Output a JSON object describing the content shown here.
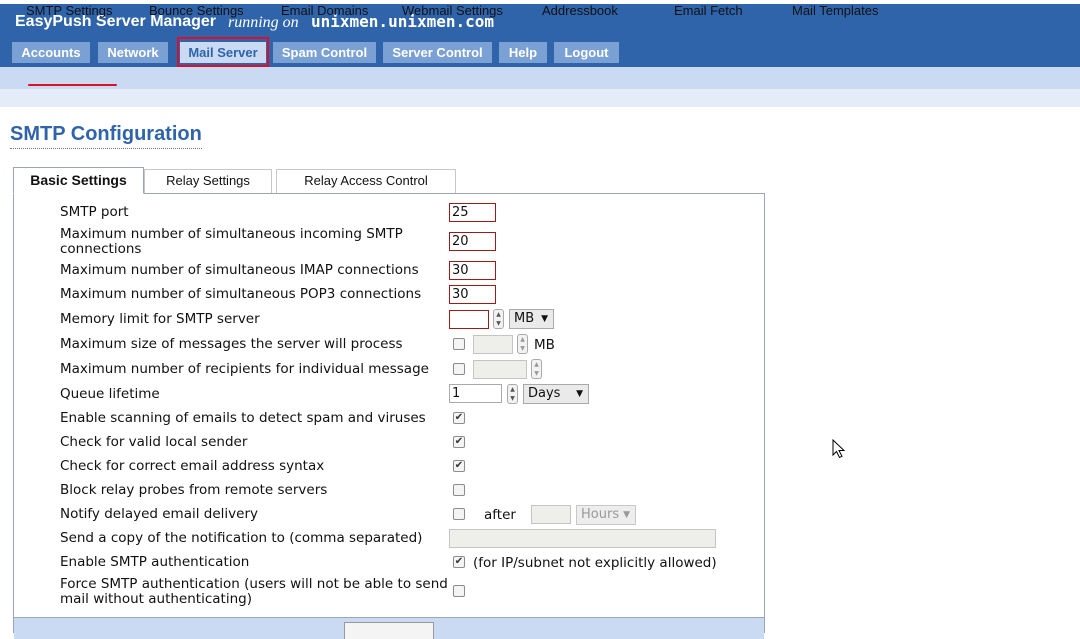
{
  "header": {
    "app_title": "EasyPush Server Manager",
    "running_on": "running on",
    "hostname": "unixmen.unixmen.com"
  },
  "main_tabs": [
    {
      "label": "Accounts"
    },
    {
      "label": "Network"
    },
    {
      "label": "Mail Server",
      "active": true
    },
    {
      "label": "Spam Control"
    },
    {
      "label": "Server Control"
    },
    {
      "label": "Help"
    },
    {
      "label": "Logout"
    }
  ],
  "sub_nav": [
    {
      "label": "SMTP Settings",
      "active": true
    },
    {
      "label": "Bounce Settings"
    },
    {
      "label": "Email Domains"
    },
    {
      "label": "Webmail Settings"
    },
    {
      "label": "Addressbook"
    },
    {
      "label": "Email Fetch"
    },
    {
      "label": "Mail Templates"
    }
  ],
  "page_title": "SMTP Configuration",
  "panel_tabs": [
    {
      "label": "Basic Settings",
      "active": true
    },
    {
      "label": "Relay Settings"
    },
    {
      "label": "Relay Access Control"
    }
  ],
  "settings": {
    "smtp_port": {
      "label": "SMTP port",
      "value": "25"
    },
    "max_incoming_smtp": {
      "label": "Maximum number of simultaneous incoming SMTP connections",
      "value": "20"
    },
    "max_imap": {
      "label": "Maximum number of simultaneous IMAP connections",
      "value": "30"
    },
    "max_pop3": {
      "label": "Maximum number of simultaneous POP3 connections",
      "value": "30"
    },
    "memory_limit": {
      "label": "Memory limit for SMTP server",
      "value": "",
      "unit": "MB"
    },
    "max_message_size": {
      "label": "Maximum size of messages the server will process",
      "value": "",
      "unit": "MB",
      "enabled": false
    },
    "max_recipients": {
      "label": "Maximum number of recipients for individual message",
      "value": "",
      "enabled": false
    },
    "queue_lifetime": {
      "label": "Queue lifetime",
      "value": "1",
      "unit": "Days"
    },
    "scan_spam_viruses": {
      "label": "Enable scanning of emails to detect spam and viruses",
      "checked": true
    },
    "check_local_sender": {
      "label": "Check for valid local sender",
      "checked": true
    },
    "check_syntax": {
      "label": "Check for correct email address syntax",
      "checked": true
    },
    "block_relay_probes": {
      "label": "Block relay probes from remote servers",
      "checked": false
    },
    "notify_delayed": {
      "label": "Notify delayed email delivery",
      "checked": false,
      "after_label": "after",
      "value": "",
      "unit": "Hours"
    },
    "notification_copy": {
      "label": "Send a copy of the notification to (comma separated)",
      "value": ""
    },
    "smtp_auth": {
      "label": "Enable SMTP authentication",
      "checked": true,
      "note": "(for IP/subnet not explicitly allowed)"
    },
    "force_smtp_auth": {
      "label": "Force SMTP authentication (users will not be able to send mail without authenticating)",
      "checked": false
    }
  },
  "colors": {
    "header_blue": "#2f64ab",
    "tab_blue": "#7aa0d4",
    "subnav_bg": "#c9daf2",
    "highlight_red": "#d8102a"
  }
}
